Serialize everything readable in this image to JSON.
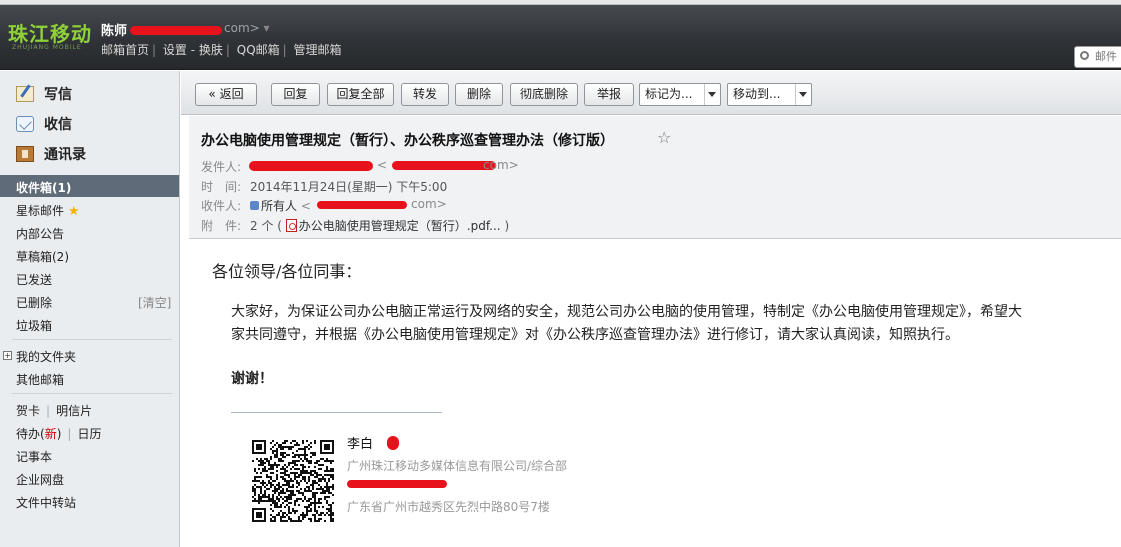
{
  "header": {
    "logo": "珠江移动",
    "logo_sub": "ZHUJIANG MOBILE",
    "user_name": "陈师",
    "user_email_tail": "com>",
    "links": [
      "邮箱首页",
      "设置",
      "换肤",
      "QQ邮箱",
      "管理邮箱"
    ],
    "search_placeholder": "邮件"
  },
  "sidebar": {
    "write": "写信",
    "receive": "收信",
    "contacts": "通讯录",
    "inbox": "收件箱(1)",
    "folders": [
      "星标邮件",
      "内部公告",
      "草稿箱(2)",
      "已发送",
      "已删除",
      "垃圾箱"
    ],
    "clear": "[清空]",
    "my_folders": "我的文件夹",
    "other_mailboxes": "其他邮箱",
    "greeting_card": "贺卡",
    "postcard": "明信片",
    "todo_prefix": "待办(",
    "todo_new": "新",
    "todo_suffix": ")",
    "calendar": "日历",
    "notebook": "记事本",
    "netdisk": "企业网盘",
    "file_transfer": "文件中转站"
  },
  "toolbar": {
    "back": "« 返回",
    "reply": "回复",
    "reply_all": "回复全部",
    "forward": "转发",
    "delete": "删除",
    "delete_permanent": "彻底删除",
    "report": "举报",
    "mark_as": "标记为...",
    "move_to": "移动到..."
  },
  "mail": {
    "subject": "办公电脑使用管理规定（暂行）、办公秩序巡查管理办法（修订版）",
    "labels": {
      "from": "发件人:",
      "time": "时　间:",
      "to": "收件人:",
      "attach": "附　件:"
    },
    "from_tail": "<",
    "from_end": "com>",
    "time": "2014年11月24日(星期一) 下午5:00",
    "to_name": "所有人",
    "to_email_tail": "<",
    "to_email_end": "com>",
    "attach_count": "2 个 (",
    "attach_file": "办公电脑使用管理规定（暂行）.pdf...",
    "attach_close": ")"
  },
  "body": {
    "greeting": "各位领导/各位同事：",
    "para_line1": "大家好，为保证公司办公电脑正常运行及网络的安全，规范公司办公电脑的使用管理，特制定《办公电脑使用管理规定》，希望大",
    "para_line2": "家共同遵守，并根据《办公电脑使用管理规定》对《办公秩序巡查管理办法》进行修订，请大家认真阅读，知照执行。",
    "thanks": "谢谢！",
    "sig_name": "李白",
    "sig_company": "广州珠江移动多媒体信息有限公司/综合部",
    "sig_address": "广东省广州市越秀区先烈中路80号7楼"
  },
  "colors": {
    "accent_logo": "#8fd13a",
    "redaction": "#e8121c",
    "inbox_selected": "#5f6b78"
  }
}
